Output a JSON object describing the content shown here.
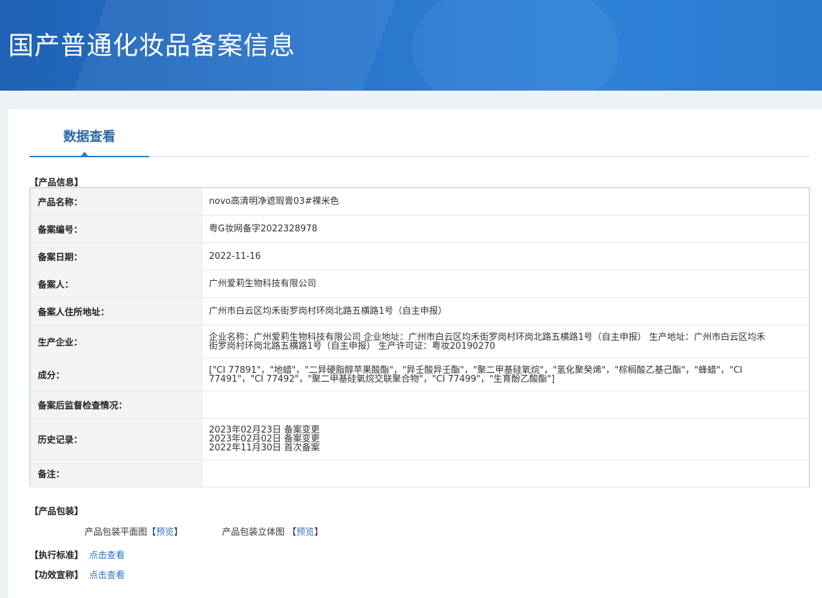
{
  "header": {
    "title": "国产普通化妆品备案信息"
  },
  "tabs": [
    {
      "label": "数据查看"
    }
  ],
  "product_info": {
    "section_title": "【产品信息】",
    "rows": [
      {
        "label": "产品名称：",
        "value": "novo高清明净遮瑕膏03#裸米色"
      },
      {
        "label": "备案编号：",
        "value": "粤G妆网备字2022328978"
      },
      {
        "label": "备案日期：",
        "value": "2022-11-16"
      },
      {
        "label": "备案人：",
        "value": "广州爱莉生物科技有限公司"
      },
      {
        "label": "备案人住所地址：",
        "value": "广州市白云区均禾街罗岗村环岗北路五横路1号（自主申报）"
      },
      {
        "label": "生产企业：",
        "value": "企业名称：广州爱莉生物科技有限公司 企业地址：广州市白云区均禾街罗岗村环岗北路五横路1号（自主申报） 生产地址：广州市白云区均禾街罗岗村环岗北路五横路1号（自主申报） 生产许可证：粤妆20190270"
      },
      {
        "label": "成分：",
        "value": "[\"CI 77891\"，\"地蜡\"，\"二异硬脂醇苹果酸酯\"，\"异壬酸异壬酯\"，\"聚二甲基硅氧烷\"，\"氢化聚癸烯\"，\"棕榈酸乙基己酯\"，\"蜂蜡\"，\"CI 77491\"，\"CI 77492\"，\"聚二甲基硅氧烷交联聚合物\"，\"CI 77499\"，\"生育酚乙酸酯\"]"
      },
      {
        "label": "备案后监督检查情况：",
        "value": ""
      },
      {
        "label": "历史记录：",
        "history": [
          "2023年02月23日 备案变更",
          "2023年02月02日 备案变更",
          "2022年11月30日 首次备案"
        ]
      },
      {
        "label": "备注：",
        "value": ""
      }
    ]
  },
  "packaging": {
    "section_title": "【产品包装】",
    "flat_label": "产品包装平面图",
    "solid_label": "产品包装立体图",
    "preview_open": "【",
    "preview_text": "预览",
    "preview_close": "】"
  },
  "standard": {
    "label": "【执行标准】",
    "link": "点击查看"
  },
  "efficacy": {
    "label": "【功效宣称】",
    "link": "点击查看"
  },
  "colors": {
    "accent": "#2f78c8",
    "banner": "#2a74cc",
    "link": "#2a6fbf"
  }
}
